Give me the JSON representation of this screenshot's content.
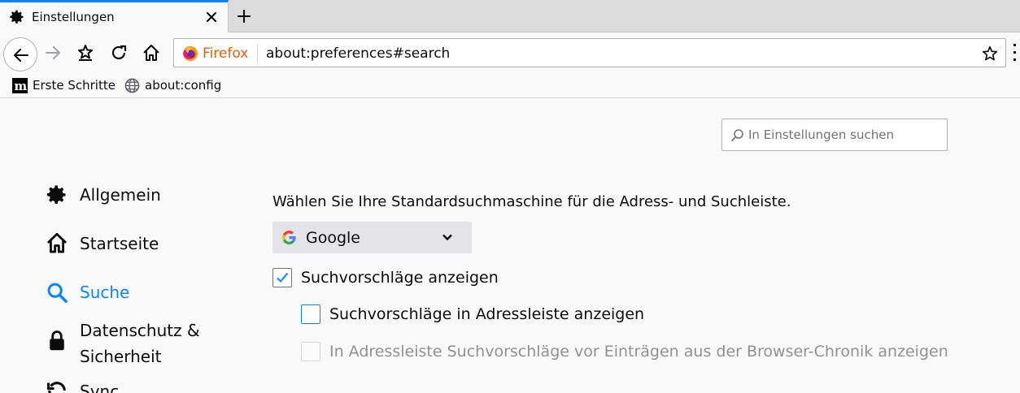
{
  "tab": {
    "title": "Einstellungen",
    "active_color": "#0a84ff"
  },
  "urlbar": {
    "identity_label": "Firefox",
    "url": "about:preferences#search"
  },
  "bookmarks": [
    {
      "label": "Erste Schritte",
      "icon": "mozilla-m-icon"
    },
    {
      "label": "about:config",
      "icon": "globe-icon"
    }
  ],
  "search": {
    "placeholder": "In Einstellungen suchen"
  },
  "categories": [
    {
      "label": "Allgemein",
      "icon": "gear-icon"
    },
    {
      "label": "Startseite",
      "icon": "home-icon"
    },
    {
      "label": "Suche",
      "icon": "search-icon",
      "selected": true
    },
    {
      "label_line1": "Datenschutz &",
      "label_line2": "Sicherheit",
      "icon": "lock-icon"
    },
    {
      "label": "Sync",
      "icon": "sync-icon"
    }
  ],
  "main": {
    "heading": "Wählen Sie Ihre Standardsuchmaschine für die Adress- und Suchleiste.",
    "engine": {
      "selected": "Google"
    },
    "options": [
      {
        "label": "Suchvorschläge anzeigen",
        "checked": true,
        "disabled": false
      },
      {
        "label": "Suchvorschläge in Adressleiste anzeigen",
        "checked": false,
        "disabled": false
      },
      {
        "label": "In Adressleiste Suchvorschläge vor Einträgen aus der Browser-Chronik anzeigen",
        "checked": false,
        "disabled": true
      }
    ]
  },
  "colors": {
    "accent": "#0a84ff",
    "firefox_orange": "#e66000",
    "disabled_text": "#919191"
  }
}
